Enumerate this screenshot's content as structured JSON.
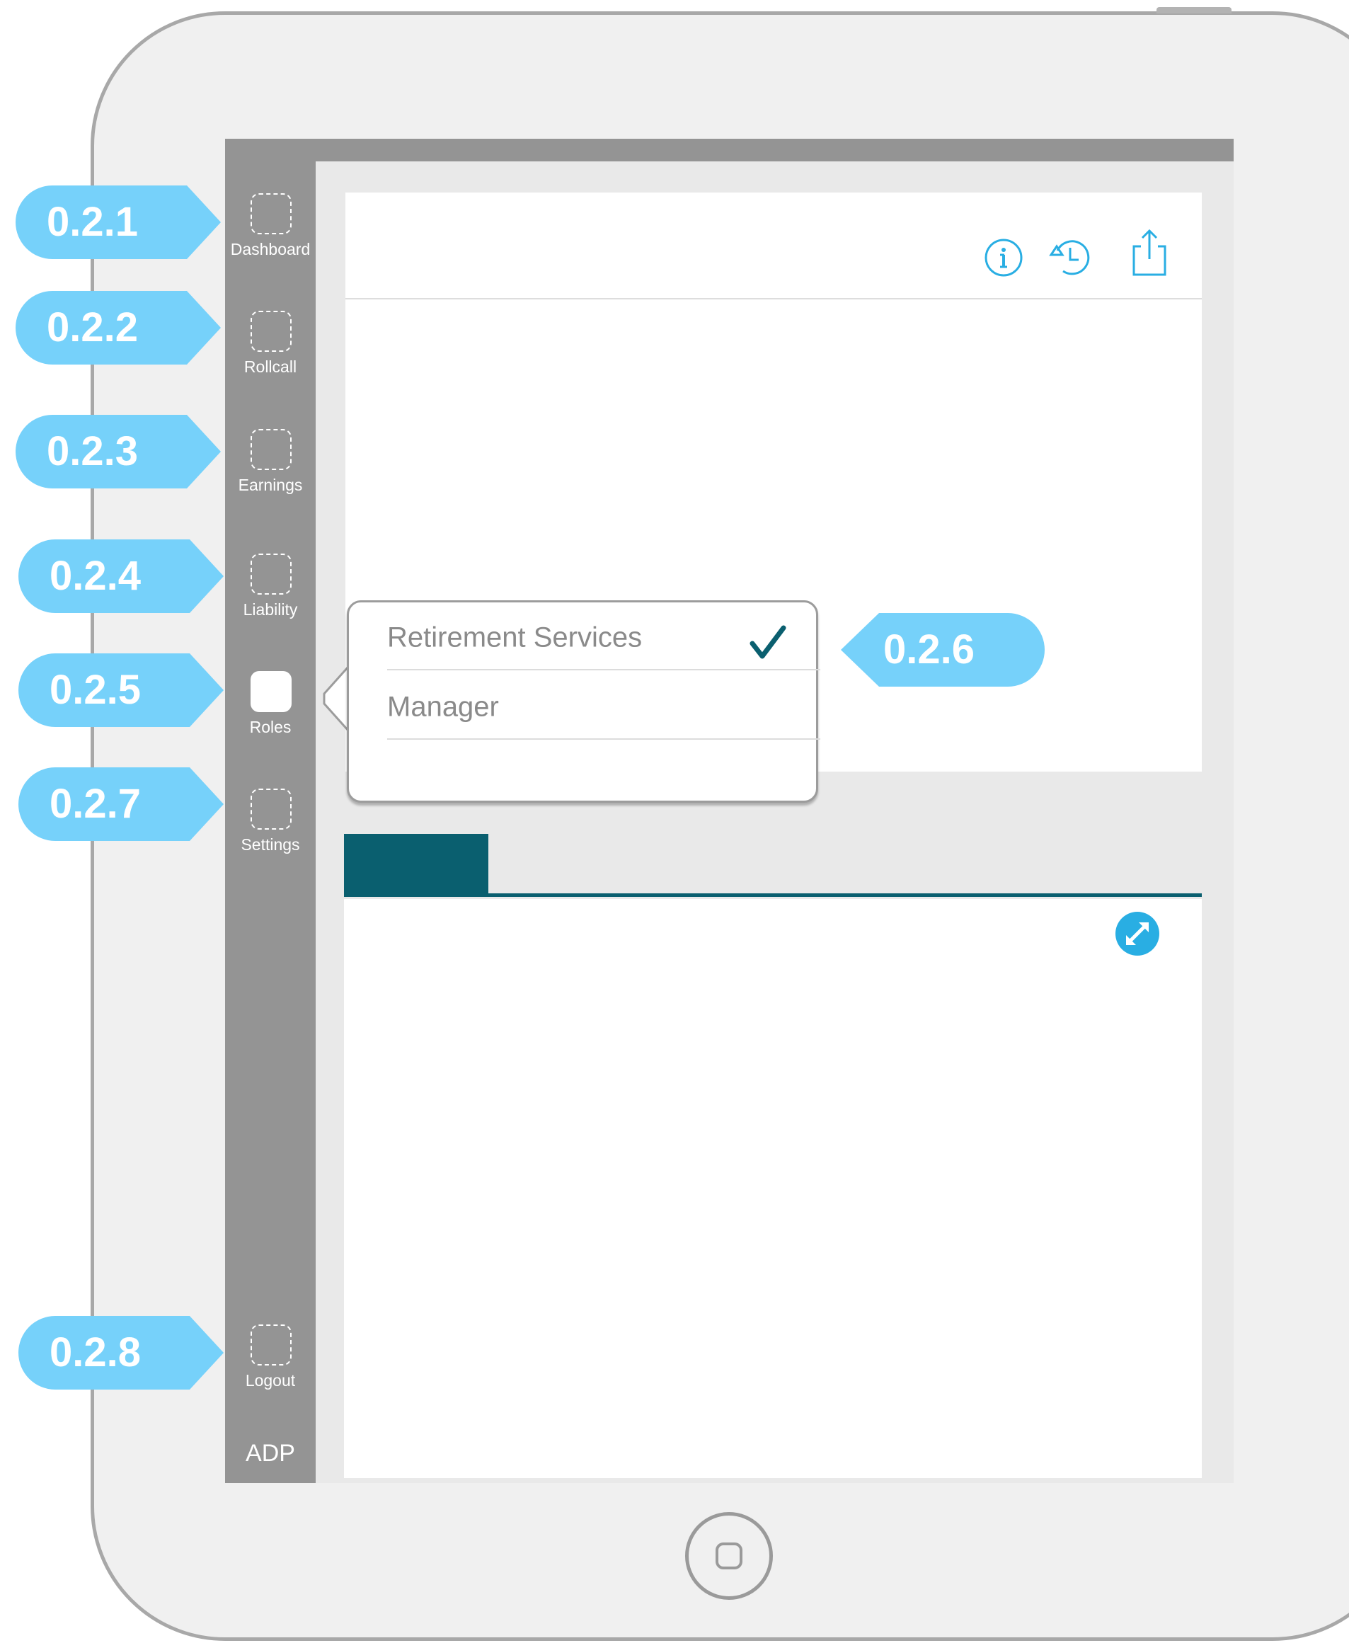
{
  "sidebar": {
    "items": [
      {
        "label": "Dashboard",
        "state": "default"
      },
      {
        "label": "Rollcall",
        "state": "default"
      },
      {
        "label": "Earnings",
        "state": "default"
      },
      {
        "label": "Liability",
        "state": "default"
      },
      {
        "label": "Roles",
        "state": "active"
      },
      {
        "label": "Settings",
        "state": "default"
      }
    ],
    "logout_label": "Logout",
    "brand": "ADP"
  },
  "toolbar": {
    "icons": [
      "info-icon",
      "history-icon",
      "share-icon"
    ]
  },
  "roles_popover": {
    "options": [
      {
        "label": "Retirement Services",
        "selected": true
      },
      {
        "label": "Manager",
        "selected": false
      }
    ]
  },
  "annotations": {
    "dashboard": "0.2.1",
    "rollcall": "0.2.2",
    "earnings": "0.2.3",
    "liability": "0.2.4",
    "roles": "0.2.5",
    "popover": "0.2.6",
    "settings": "0.2.7",
    "logout": "0.2.8"
  },
  "colors": {
    "accent": "#0a5f6f",
    "icon_blue": "#29aee3",
    "annotation": "#76d1fa",
    "sidebar": "#949494"
  }
}
